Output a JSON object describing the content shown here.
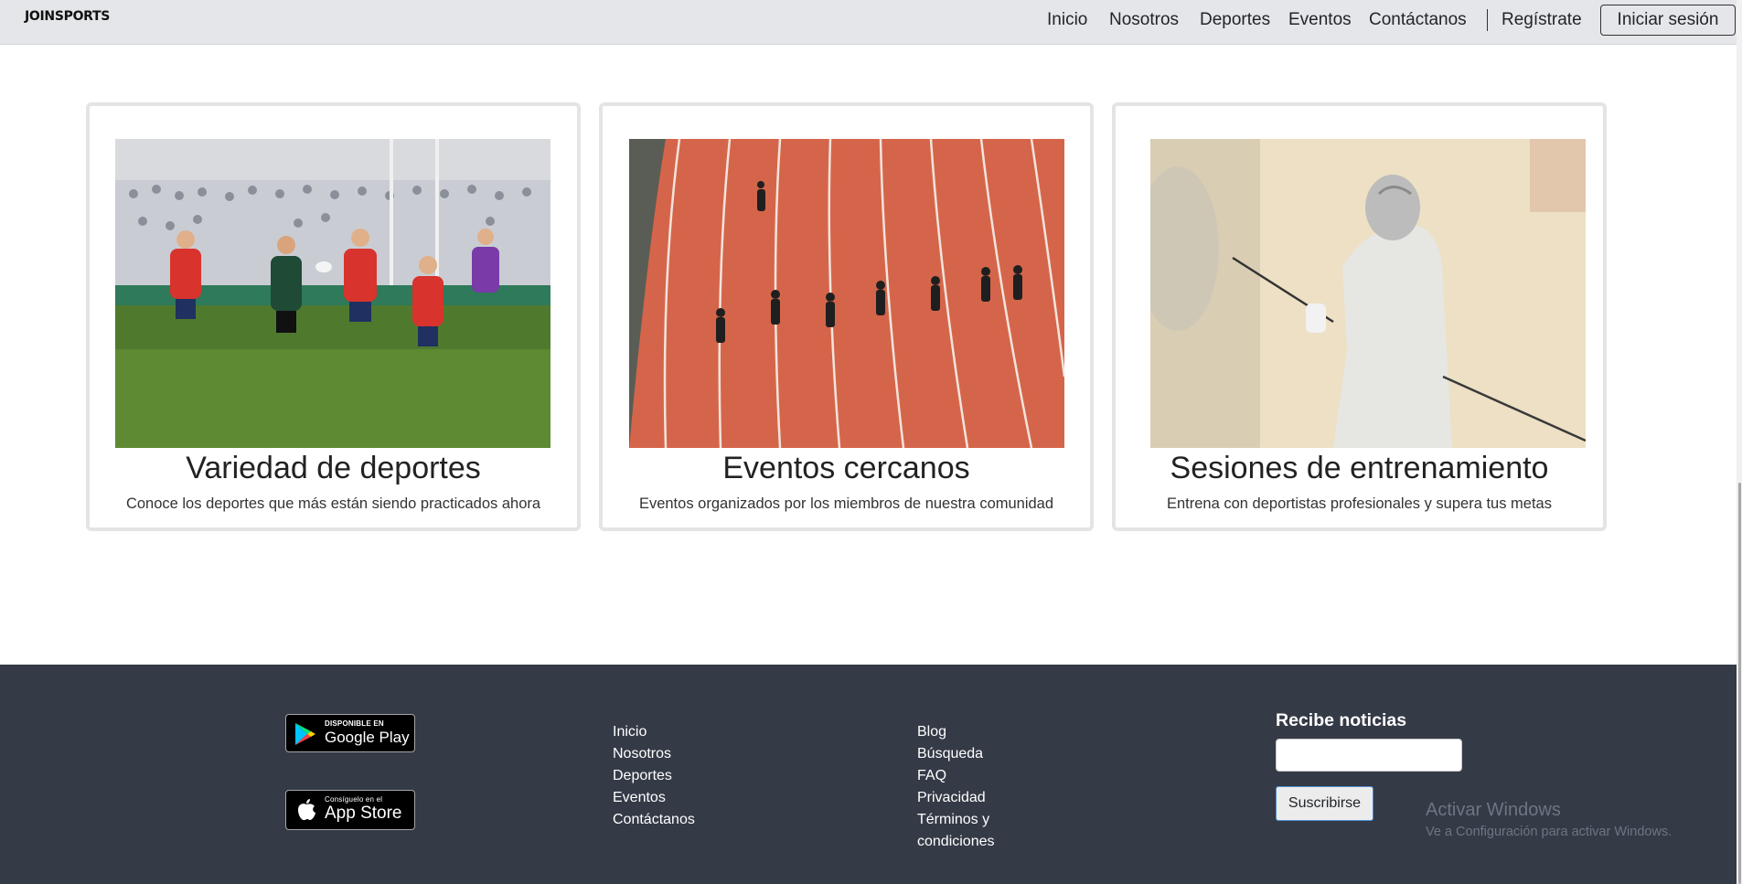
{
  "header": {
    "logo": "JOINSPORTS",
    "nav": [
      "Inicio",
      "Nosotros",
      "Deportes",
      "Eventos",
      "Contáctanos"
    ],
    "register": "Regístrate",
    "login": "Iniciar sesión"
  },
  "cards": [
    {
      "title": "Variedad de deportes",
      "text": "Conoce los deportes que más están siendo practicados ahora",
      "image": "rugby-photo"
    },
    {
      "title": "Eventos cercanos",
      "text": "Eventos organizados por los miembros de nuestra comunidad",
      "image": "athletics-track-photo"
    },
    {
      "title": "Sesiones de entrenamiento",
      "text": "Entrena con deportistas profesionales y supera tus metas",
      "image": "fencing-photo"
    }
  ],
  "footer": {
    "google_play": {
      "small": "DISPONIBLE EN",
      "big": "Google Play"
    },
    "app_store": {
      "small": "Consíguelo en el",
      "big": "App Store"
    },
    "links_col1": [
      "Inicio",
      "Nosotros",
      "Deportes",
      "Eventos",
      "Contáctanos"
    ],
    "links_col2": [
      "Blog",
      "Búsqueda",
      "FAQ",
      "Privacidad",
      "Términos y",
      "condiciones"
    ],
    "newsletter_title": "Recibe noticias",
    "newsletter_input": "",
    "subscribe": "Suscribirse"
  },
  "windows_watermark": {
    "title": "Activar Windows",
    "subtitle": "Ve a Configuración para activar Windows."
  },
  "colors": {
    "header_bg": "#e5e6e9",
    "footer_bg": "#343a46",
    "card_border": "#e4e4e4",
    "track_orange": "#d5654a"
  }
}
